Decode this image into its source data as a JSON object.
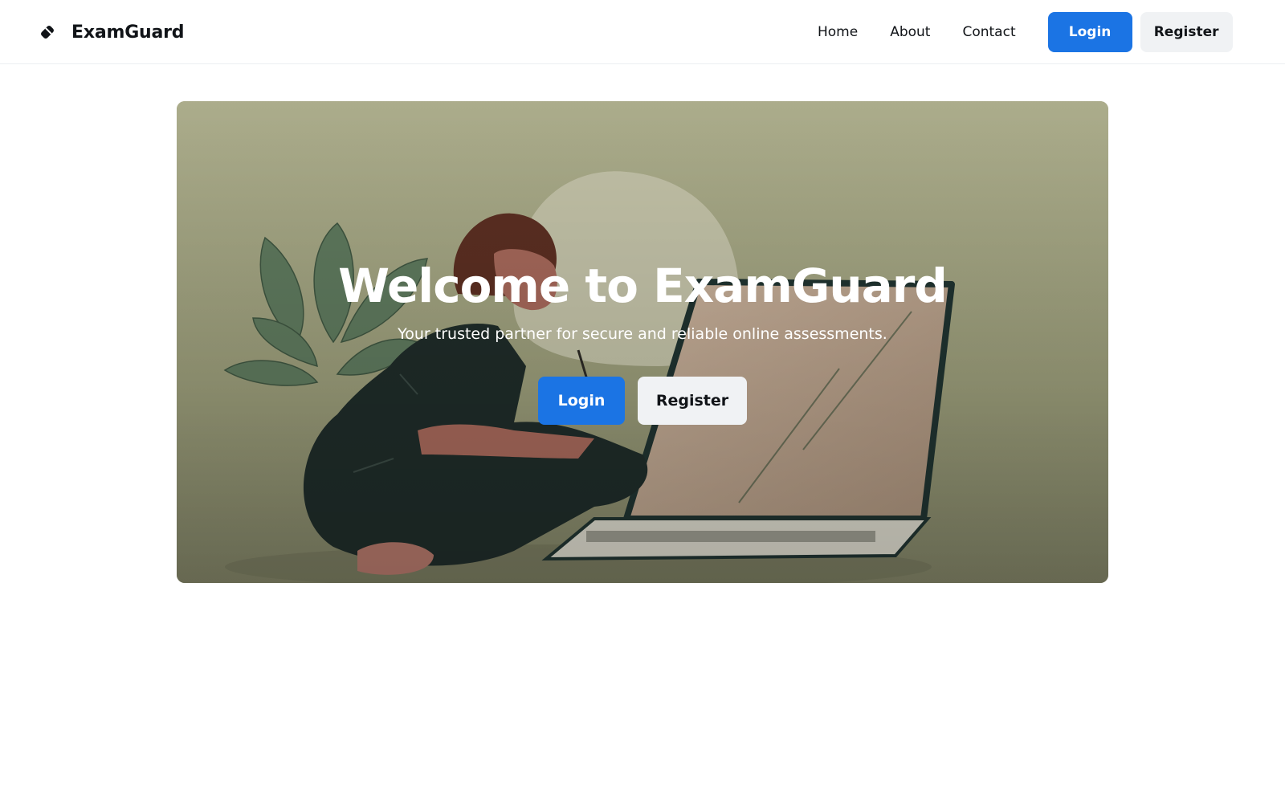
{
  "header": {
    "brand_name": "ExamGuard",
    "brand_icon": "eraser-icon",
    "nav": {
      "home": "Home",
      "about": "About",
      "contact": "Contact"
    },
    "login_label": "Login",
    "register_label": "Register"
  },
  "hero": {
    "title": "Welcome to ExamGuard",
    "subtitle": "Your trusted partner for secure and reliable online assessments.",
    "login_label": "Login",
    "register_label": "Register",
    "illustration": "person-sitting-with-laptop-and-plant"
  },
  "colors": {
    "primary": "#1b74e4",
    "secondary_button": "#f0f2f4",
    "text": "#111418",
    "hero_background": "#a9a884"
  }
}
